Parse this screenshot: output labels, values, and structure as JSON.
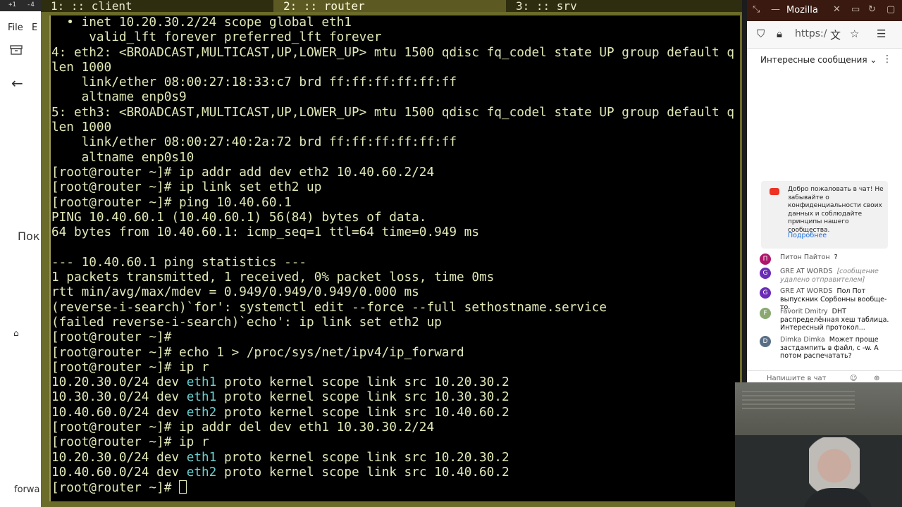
{
  "tray": {
    "left": "+1",
    "mid": "-4"
  },
  "left_app": {
    "menu_file": "File",
    "menu_edit": "E",
    "heading_partial": "Пок",
    "bottom_text": "forwa"
  },
  "terminal": {
    "tabs": [
      {
        "label": "1: :: client"
      },
      {
        "label": "2: :: router"
      },
      {
        "label": "3: :: srv"
      }
    ],
    "lines": [
      "  • inet 10.20.30.2/24 scope global eth1",
      "     valid_lft forever preferred_lft forever",
      "4: eth2: <BROADCAST,MULTICAST,UP,LOWER_UP> mtu 1500 qdisc fq_codel state UP group default q",
      "len 1000",
      "    link/ether 08:00:27:18:33:c7 brd ff:ff:ff:ff:ff:ff",
      "    altname enp0s9",
      "5: eth3: <BROADCAST,MULTICAST,UP,LOWER_UP> mtu 1500 qdisc fq_codel state UP group default q",
      "len 1000",
      "    link/ether 08:00:27:40:2a:72 brd ff:ff:ff:ff:ff:ff",
      "    altname enp0s10",
      "[root@router ~]# ip addr add dev eth2 10.40.60.2/24",
      "[root@router ~]# ip link set eth2 up",
      "[root@router ~]# ping 10.40.60.1",
      "PING 10.40.60.1 (10.40.60.1) 56(84) bytes of data.",
      "64 bytes from 10.40.60.1: icmp_seq=1 ttl=64 time=0.949 ms",
      "",
      "--- 10.40.60.1 ping statistics ---",
      "1 packets transmitted, 1 received, 0% packet loss, time 0ms",
      "rtt min/avg/max/mdev = 0.949/0.949/0.949/0.000 ms",
      "(reverse-i-search)`for': systemctl edit --force --full sethostname.service",
      "(failed reverse-i-search)`echo': ip link set eth2 up",
      "[root@router ~]#",
      "[root@router ~]# echo 1 > /proc/sys/net/ipv4/ip_forward",
      "[root@router ~]# ip r"
    ],
    "routes1": [
      {
        "net": "10.20.30.0/24 dev ",
        "iface": "eth1",
        "rest": " proto kernel scope link src 10.20.30.2"
      },
      {
        "net": "10.30.30.0/24 dev ",
        "iface": "eth1",
        "rest": " proto kernel scope link src 10.30.30.2"
      },
      {
        "net": "10.40.60.0/24 dev ",
        "iface": "eth2",
        "rest": " proto kernel scope link src 10.40.60.2"
      }
    ],
    "cmd_del": "[root@router ~]# ip addr del dev eth1 10.30.30.2/24",
    "cmd_ipr": "[root@router ~]# ip r",
    "routes2": [
      {
        "net": "10.20.30.0/24 dev ",
        "iface": "eth1",
        "rest": " proto kernel scope link src 10.20.30.2"
      },
      {
        "net": "10.40.60.0/24 dev ",
        "iface": "eth2",
        "rest": " proto kernel scope link src 10.40.60.2"
      }
    ],
    "prompt": "[root@router ~]# "
  },
  "browser": {
    "title": "Mozilla",
    "url": "https:/",
    "chat_title": "Интересные сообщения",
    "welcome_text": "Добро пожаловать в чат! Не забывайте о конфиденциальности своих данных и соблюдайте принципы нашего сообщества.",
    "welcome_link": "Подробнее",
    "messages": [
      {
        "initial": "П",
        "color": "#b0166b",
        "author": "Питон Пайтон",
        "text": "?",
        "deleted": ""
      },
      {
        "initial": "G",
        "color": "#6a2bb6",
        "author": "GRE AT WORDS",
        "text": "",
        "deleted": "[сообщение удалено отправителем]"
      },
      {
        "initial": "G",
        "color": "#6a2bb6",
        "author": "GRE AT WORDS",
        "text": "Пол Пот выпускник Сорбонны вообще-то.",
        "deleted": ""
      },
      {
        "initial": "F",
        "color": "#8aa870",
        "author": "Favorit Dmitry",
        "text": "DHT распределённая хеш таблица. Интересный протокол...",
        "deleted": ""
      },
      {
        "initial": "D",
        "color": "#5a6f86",
        "author": "Dimka Dimka",
        "text": "Может проще застдампить в файл, с -w. А потом распечатать?",
        "deleted": ""
      }
    ],
    "input_placeholder": "Напишите в чат"
  }
}
